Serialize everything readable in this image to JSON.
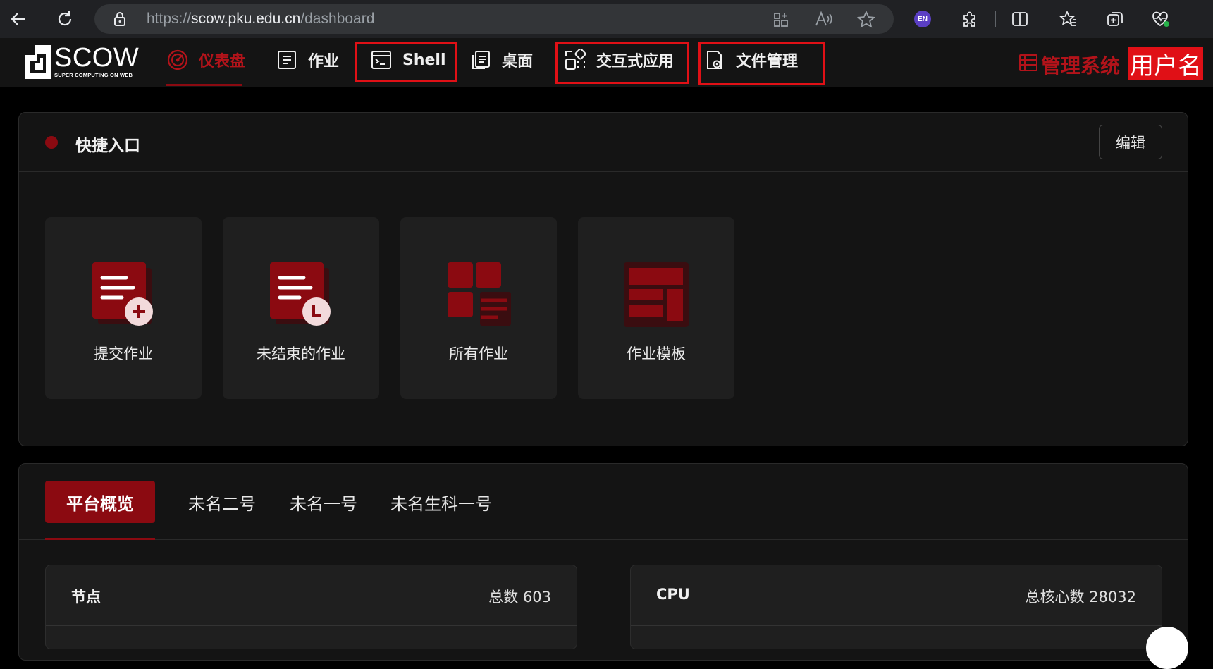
{
  "browser": {
    "url_scheme": "https://",
    "url_host": "scow.pku.edu.cn",
    "url_path": "/dashboard",
    "profile_badge": "EN"
  },
  "app": {
    "logo_title": "SCOW",
    "logo_subtitle": "SUPER COMPUTING ON WEB",
    "nav": [
      {
        "label": "仪表盘",
        "icon": "dashboard-icon",
        "active": true
      },
      {
        "label": "作业",
        "icon": "job-list-icon"
      },
      {
        "label": "Shell",
        "icon": "terminal-icon"
      },
      {
        "label": "桌面",
        "icon": "desktop-icon"
      },
      {
        "label": "交互式应用",
        "icon": "apps-icon"
      },
      {
        "label": "文件管理",
        "icon": "file-manager-icon"
      }
    ],
    "admin_label": "管理系统",
    "username": "用户名",
    "accent_color": "#8b0a11",
    "highlight_color": "#e01016"
  },
  "quick_access": {
    "title": "快捷入口",
    "edit_label": "编辑",
    "tiles": [
      {
        "label": "提交作业",
        "icon": "submit-job-icon"
      },
      {
        "label": "未结束的作业",
        "icon": "running-jobs-icon"
      },
      {
        "label": "所有作业",
        "icon": "all-jobs-icon"
      },
      {
        "label": "作业模板",
        "icon": "job-template-icon"
      }
    ]
  },
  "overview": {
    "tabs": [
      "平台概览",
      "未名二号",
      "未名一号",
      "未名生科一号"
    ],
    "stats": [
      {
        "title": "节点",
        "total": "总数 603"
      },
      {
        "title": "CPU",
        "total": "总核心数 28032"
      }
    ]
  }
}
